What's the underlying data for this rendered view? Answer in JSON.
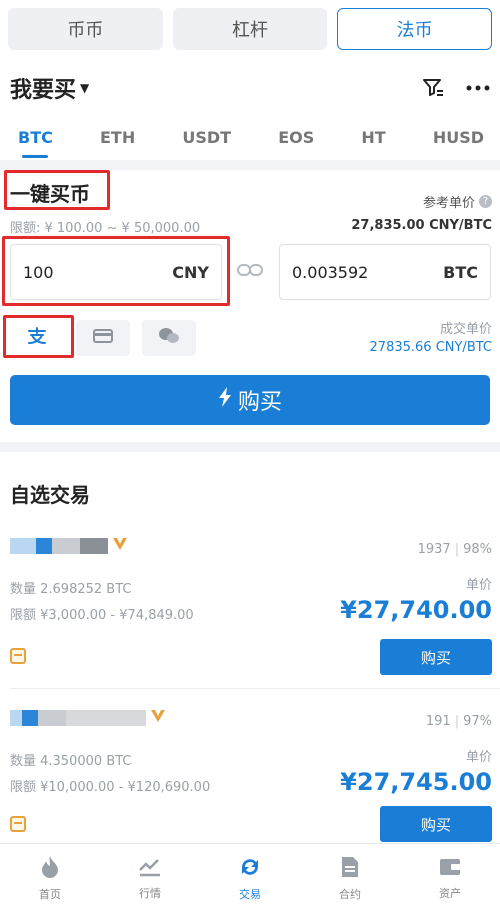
{
  "top_tabs": [
    {
      "label": "币币"
    },
    {
      "label": "杠杆"
    },
    {
      "label": "法币"
    }
  ],
  "header": {
    "title": "我要买"
  },
  "coin_tabs": [
    {
      "label": "BTC"
    },
    {
      "label": "ETH"
    },
    {
      "label": "USDT"
    },
    {
      "label": "EOS"
    },
    {
      "label": "HT"
    },
    {
      "label": "HUSD"
    }
  ],
  "quick_buy": {
    "title": "一键买币",
    "limit": "限额: ¥ 100.00 ~ ¥ 50,000.00",
    "ref_label": "参考单价",
    "ref_price": "27,835.00 CNY/BTC",
    "cny_value": "100",
    "cny_unit": "CNY",
    "btc_value": "0.003592",
    "btc_unit": "BTC",
    "deal_label": "成交单价",
    "deal_price": "27835.66 CNY/BTC",
    "buy_label": "购买"
  },
  "favorites": {
    "title": "自选交易",
    "orders": [
      {
        "orders_count": "1937",
        "rate": "98%",
        "quantity": "数量 2.698252 BTC",
        "limit": "限额 ¥3,000.00 - ¥74,849.00",
        "unit_label": "单价",
        "price": "¥27,740.00",
        "buy_label": "购买"
      },
      {
        "orders_count": "191",
        "rate": "97%",
        "quantity": "数量 4.350000 BTC",
        "limit": "限额 ¥10,000.00 - ¥120,690.00",
        "unit_label": "单价",
        "price": "¥27,745.00",
        "buy_label": "购买"
      }
    ]
  },
  "bottom_nav": [
    {
      "label": "首页",
      "icon": "home-flame-icon"
    },
    {
      "label": "行情",
      "icon": "market-chart-icon"
    },
    {
      "label": "交易",
      "icon": "trade-swap-icon"
    },
    {
      "label": "合约",
      "icon": "contract-icon"
    },
    {
      "label": "资产",
      "icon": "wallet-icon"
    }
  ],
  "colors": {
    "accent": "#1a7ed6",
    "highlight": "#e32b2b",
    "gold": "#e6a23c"
  }
}
